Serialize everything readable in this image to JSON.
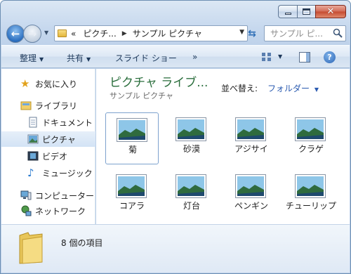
{
  "address": {
    "overflow": "«",
    "crumbs": [
      "ピクチ...",
      "サンプル ピクチャ"
    ]
  },
  "search": {
    "placeholder": "サンプル ピ..."
  },
  "toolbar": {
    "organize": "整理",
    "share": "共有",
    "slideshow": "スライド ショー",
    "more": "»",
    "help": "?"
  },
  "nav": {
    "favorites": "お気に入り",
    "libraries": "ライブラリ",
    "documents": "ドキュメント",
    "pictures": "ピクチャ",
    "videos": "ビデオ",
    "music": "ミュージック",
    "computer": "コンピューター",
    "network": "ネットワーク"
  },
  "library": {
    "title": "ピクチャ ライブ...",
    "subtitle": "サンプル ピクチャ",
    "arrange_label": "並べ替え:",
    "arrange_value": "フォルダー"
  },
  "files": [
    "菊",
    "砂漠",
    "アジサイ",
    "クラゲ",
    "コアラ",
    "灯台",
    "ペンギン",
    "チューリップ"
  ],
  "details": {
    "item_count": "8 個の項目"
  }
}
